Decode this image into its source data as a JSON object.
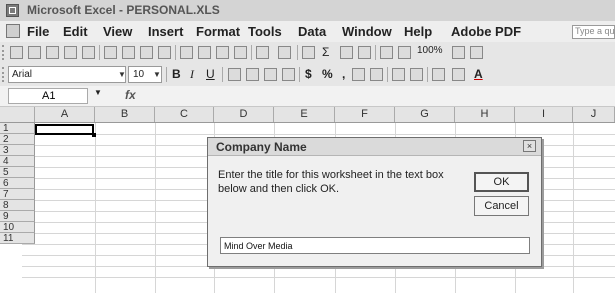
{
  "window": {
    "title": "Microsoft Excel - PERSONAL.XLS"
  },
  "menubar": {
    "items": [
      "File",
      "Edit",
      "View",
      "Insert",
      "Format",
      "Tools",
      "Data",
      "Window",
      "Help",
      "Adobe PDF"
    ],
    "ask_placeholder": "Type a questi"
  },
  "formatting": {
    "font": "Arial",
    "size": "10",
    "zoom": "100%"
  },
  "formula_bar": {
    "cell": "A1",
    "fx": "fx"
  },
  "columns": [
    "A",
    "B",
    "C",
    "D",
    "E",
    "F",
    "G",
    "H",
    "I",
    "J"
  ],
  "rows": [
    "1",
    "2",
    "3",
    "4",
    "5",
    "6",
    "7",
    "8",
    "9",
    "10",
    "11"
  ],
  "dialog": {
    "title": "Company Name",
    "prompt": "Enter the title for this worksheet in the text box below and then click OK.",
    "ok_label": "OK",
    "cancel_label": "Cancel",
    "input_value": "Mind Over Media",
    "close_glyph": "×"
  }
}
